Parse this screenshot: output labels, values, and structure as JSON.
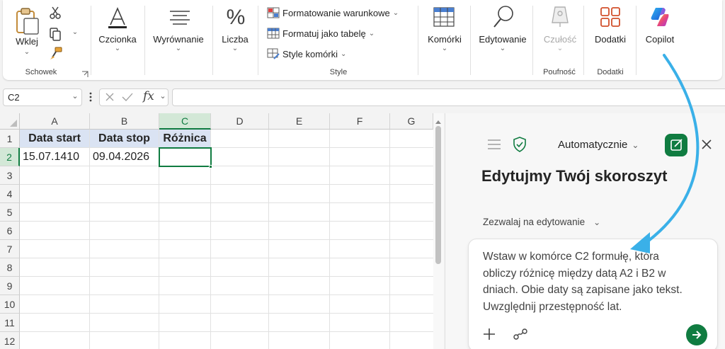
{
  "ribbon": {
    "clipboard": {
      "paste_label": "Wklej",
      "group_label": "Schowek"
    },
    "font": {
      "label": "Czcionka"
    },
    "alignment": {
      "label": "Wyrównanie"
    },
    "number": {
      "label": "Liczba"
    },
    "styles": {
      "conditional_formatting": "Formatowanie warunkowe",
      "format_as_table": "Formatuj jako tabelę",
      "cell_styles": "Style komórki",
      "group_label": "Style"
    },
    "cells": {
      "label": "Komórki"
    },
    "editing": {
      "label": "Edytowanie"
    },
    "sensitivity": {
      "label": "Czułość",
      "group_label": "Poufność"
    },
    "addins": {
      "label": "Dodatki",
      "group_label": "Dodatki"
    },
    "copilot": {
      "label": "Copilot"
    }
  },
  "formula_bar": {
    "name_box": "C2",
    "fx_label": "fx",
    "formula": ""
  },
  "sheet": {
    "columns": [
      "A",
      "B",
      "C",
      "D",
      "E",
      "F",
      "G"
    ],
    "rows": [
      "1",
      "2",
      "3",
      "4",
      "5",
      "6",
      "7",
      "8",
      "9",
      "10",
      "11",
      "12"
    ],
    "cells": {
      "A1": "Data  start",
      "B1": "Data stop",
      "C1": "Różnica",
      "A2": "15.07.1410",
      "B2": "09.04.2026",
      "C2": ""
    }
  },
  "copilot_pane": {
    "mode": "Automatycznie",
    "title": "Edytujmy Twój skoroszyt",
    "permission": "Zezwalaj na edytowanie",
    "prompt": "Wstaw w komórce C2 formułę, która obliczy różnicę między datą A2 i B2 w dniach. Obie daty są zapisane jako tekst. Uwzględnij przestępność lat."
  },
  "colors": {
    "accent_green": "#107c41",
    "header_fill": "#dae3f3",
    "arrow": "#3ab0e8"
  }
}
